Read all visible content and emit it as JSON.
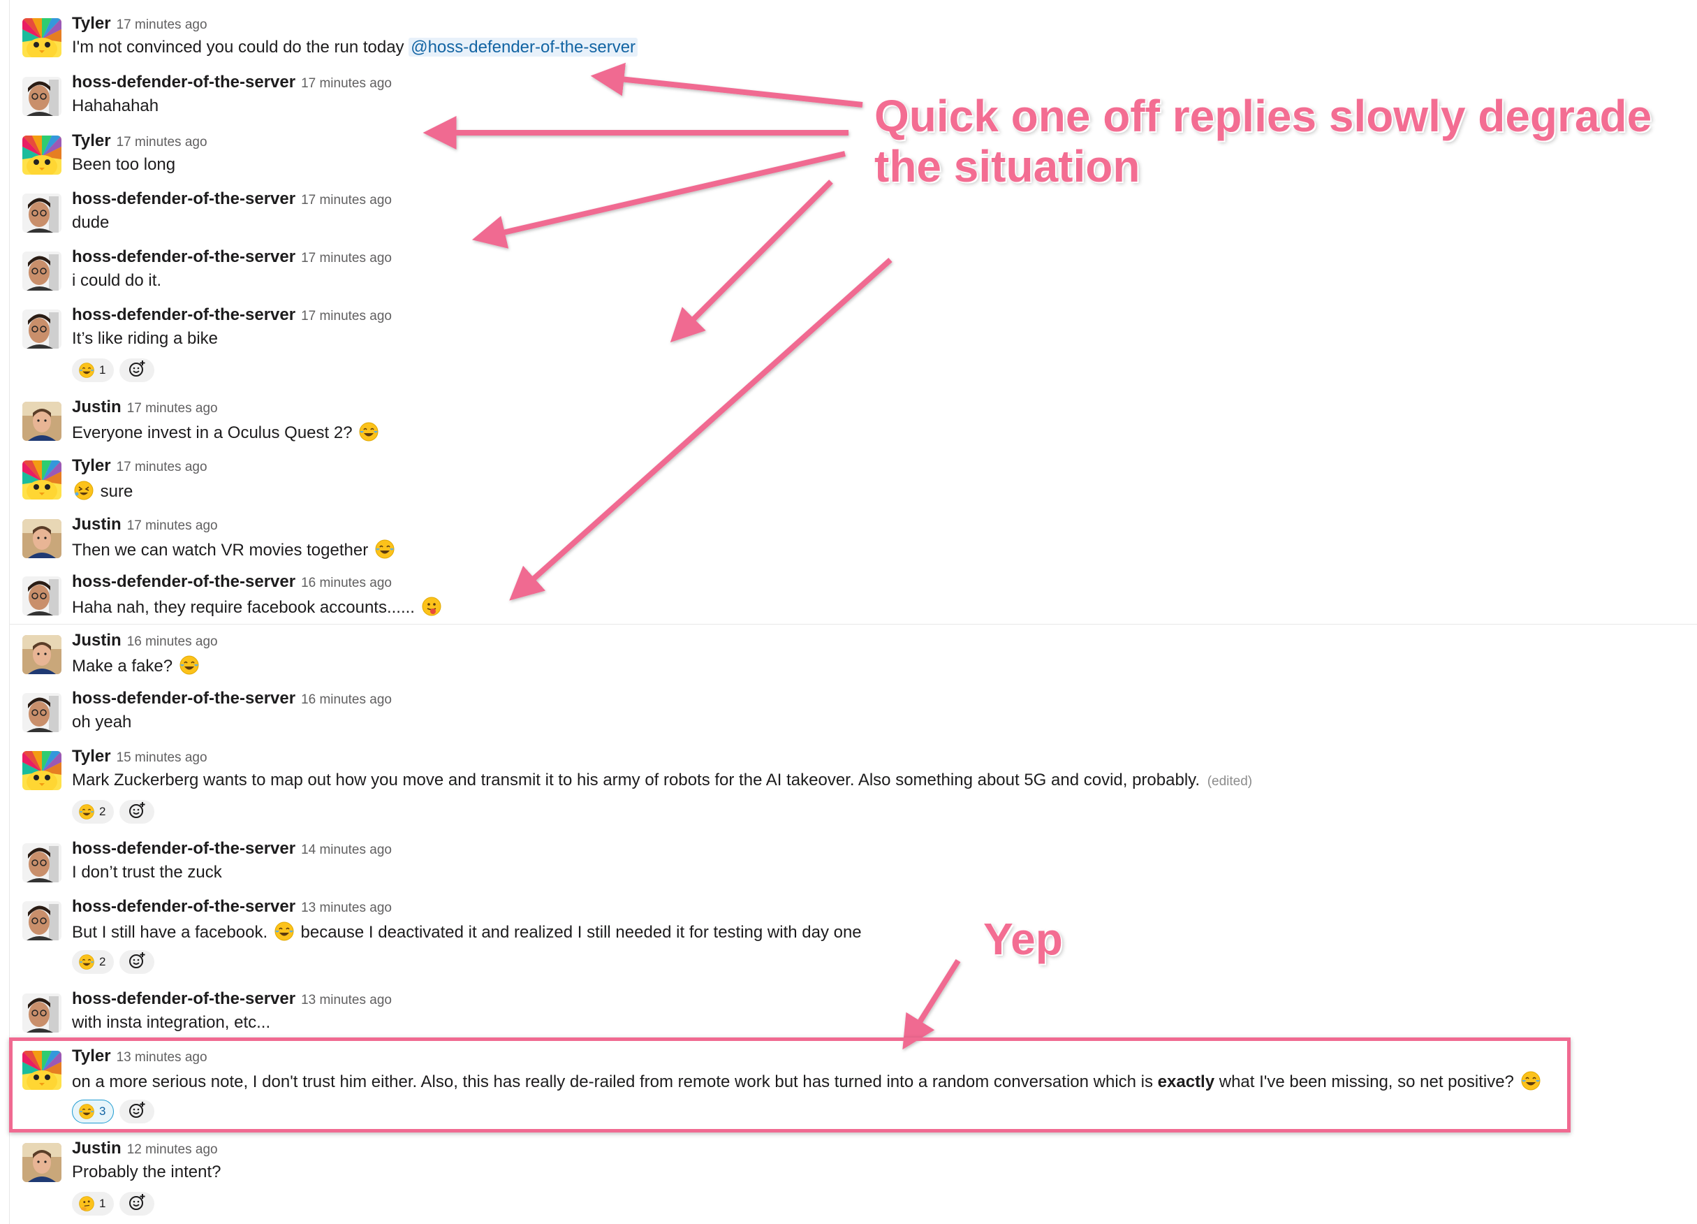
{
  "messages": [
    {
      "author": "Tyler",
      "time": "17 minutes ago",
      "avatar": "tyler",
      "parts": [
        {
          "t": "I'm not convinced you could do the run today "
        },
        {
          "t": "@hoss-defender-of-the-server",
          "mention": true
        }
      ]
    },
    {
      "author": "hoss-defender-of-the-server",
      "time": "17 minutes ago",
      "avatar": "hoss",
      "parts": [
        {
          "t": "Hahahahah"
        }
      ]
    },
    {
      "author": "Tyler",
      "time": "17 minutes ago",
      "avatar": "tyler",
      "parts": [
        {
          "t": "Been too long"
        }
      ]
    },
    {
      "author": "hoss-defender-of-the-server",
      "time": "17 minutes ago",
      "avatar": "hoss",
      "parts": [
        {
          "t": "dude"
        }
      ]
    },
    {
      "author": "hoss-defender-of-the-server",
      "time": "17 minutes ago",
      "avatar": "hoss",
      "parts": [
        {
          "t": "i could do it."
        }
      ]
    },
    {
      "author": "hoss-defender-of-the-server",
      "time": "17 minutes ago",
      "avatar": "hoss",
      "parts": [
        {
          "t": "It’s like riding a bike"
        }
      ],
      "reactions": [
        {
          "emoji": "joy",
          "count": "1"
        }
      ]
    },
    {
      "author": "Justin",
      "time": "17 minutes ago",
      "avatar": "justin",
      "parts": [
        {
          "t": "Everyone invest in a Oculus Quest 2? "
        },
        {
          "emoji": "joy"
        }
      ]
    },
    {
      "author": "Tyler",
      "time": "17 minutes ago",
      "avatar": "tyler",
      "parts": [
        {
          "emoji": "rofl"
        },
        {
          "t": " sure"
        }
      ]
    },
    {
      "author": "Justin",
      "time": "17 minutes ago",
      "avatar": "justin",
      "parts": [
        {
          "t": "Then we can watch VR movies together "
        },
        {
          "emoji": "joy"
        }
      ]
    },
    {
      "author": "hoss-defender-of-the-server",
      "time": "16 minutes ago",
      "avatar": "hoss",
      "parts": [
        {
          "t": "Haha nah, they require facebook accounts...... "
        },
        {
          "emoji": "tongue"
        }
      ]
    },
    {
      "author": "Justin",
      "time": "16 minutes ago",
      "avatar": "justin",
      "parts": [
        {
          "t": "Make a fake? "
        },
        {
          "emoji": "joy"
        }
      ]
    },
    {
      "author": "hoss-defender-of-the-server",
      "time": "16 minutes ago",
      "avatar": "hoss",
      "parts": [
        {
          "t": "oh yeah"
        }
      ]
    },
    {
      "author": "Tyler",
      "time": "15 minutes ago",
      "avatar": "tyler",
      "parts": [
        {
          "t": "Mark Zuckerberg wants to map out how you move and transmit it to his army of robots for the AI takeover. Also something about 5G and covid, probably. "
        },
        {
          "t": "(edited)",
          "edited": true
        }
      ],
      "reactions": [
        {
          "emoji": "joy",
          "count": "2"
        }
      ]
    },
    {
      "author": "hoss-defender-of-the-server",
      "time": "14 minutes ago",
      "avatar": "hoss",
      "parts": [
        {
          "t": "I don’t trust the zuck"
        }
      ]
    },
    {
      "author": "hoss-defender-of-the-server",
      "time": "13 minutes ago",
      "avatar": "hoss",
      "parts": [
        {
          "t": "But I still have a facebook. "
        },
        {
          "emoji": "joy"
        },
        {
          "t": " because I deactivated it and realized I still needed it for testing with day one"
        }
      ],
      "reactions": [
        {
          "emoji": "joy",
          "count": "2"
        }
      ]
    },
    {
      "author": "hoss-defender-of-the-server",
      "time": "13 minutes ago",
      "avatar": "hoss",
      "parts": [
        {
          "t": "with insta integration, etc..."
        }
      ]
    },
    {
      "author": "Tyler",
      "time": "13 minutes ago",
      "avatar": "tyler",
      "parts": [
        {
          "t": "on a more serious note, I don't trust him either. Also, this has really de-railed from remote work but has turned into a random conversation which is "
        },
        {
          "t": "exactly",
          "bold": true
        },
        {
          "t": " what I've been missing, so net positive? "
        },
        {
          "emoji": "joy"
        }
      ],
      "reactions": [
        {
          "emoji": "joy",
          "count": "3",
          "mine": true
        }
      ]
    },
    {
      "author": "Justin",
      "time": "12 minutes ago",
      "avatar": "justin",
      "parts": [
        {
          "t": "Probably the intent?"
        }
      ],
      "reactions": [
        {
          "emoji": "thinking",
          "count": "1"
        }
      ]
    }
  ],
  "annotations": {
    "callout_main_line1": "Quick one off replies slowly degrade",
    "callout_main_line2": "the situation",
    "callout_yep": "Yep",
    "accent_color": "#f06a91"
  },
  "colors": {
    "mention": "#1264a3",
    "mention_bg": "#e8f1fa",
    "reaction_mine_border": "#1d9bd1"
  }
}
